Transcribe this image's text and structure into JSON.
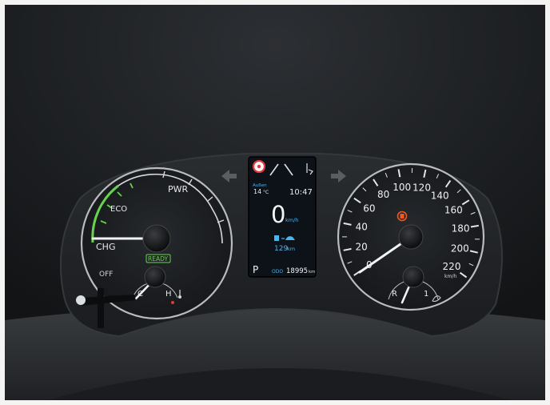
{
  "colors": {
    "frame_white": "#f4f4f2",
    "hood_dark": "#17191b",
    "panel": "#202326",
    "dial_face": "#1b1e21",
    "ring_silver": "#b9bdc0",
    "eco_green": "#67d24e",
    "screen_bg": "#0d1118",
    "accent_blue": "#48b6f0",
    "warn_orange": "#f25a1c",
    "limit_red": "#e23a3a"
  },
  "power_meter": {
    "labels": {
      "pwr": "PWR",
      "eco": "ECO",
      "chg": "CHG",
      "off": "OFF"
    },
    "ready": "READY",
    "fuel": {
      "cold": "C",
      "hot": "H"
    },
    "icons": [
      "temperature-icon"
    ]
  },
  "center_display": {
    "outside": {
      "label": "Außen",
      "temp": "14",
      "unit": "°C"
    },
    "clock": "10:47",
    "speed": {
      "value": "0",
      "unit": "km/h"
    },
    "range": {
      "value": "129",
      "unit": "km"
    },
    "gear": "P",
    "odometer": {
      "label": "ODO",
      "value": "18995",
      "unit": "km"
    },
    "icons": [
      "speed-limit-sign-icon",
      "lane-assist-icon",
      "seat-belt-icon",
      "ev-battery-icon"
    ]
  },
  "speedometer": {
    "ticks": [
      "0",
      "20",
      "40",
      "60",
      "80",
      "100",
      "120",
      "140",
      "160",
      "180",
      "200",
      "220"
    ],
    "unit": "km/h",
    "small_gauge": {
      "left": "R",
      "right": "1"
    },
    "icons": [
      "parking-brake-icon",
      "eco-leaf-icon"
    ]
  },
  "turn_signals": [
    "left-turn-arrow-icon",
    "right-turn-arrow-icon"
  ]
}
